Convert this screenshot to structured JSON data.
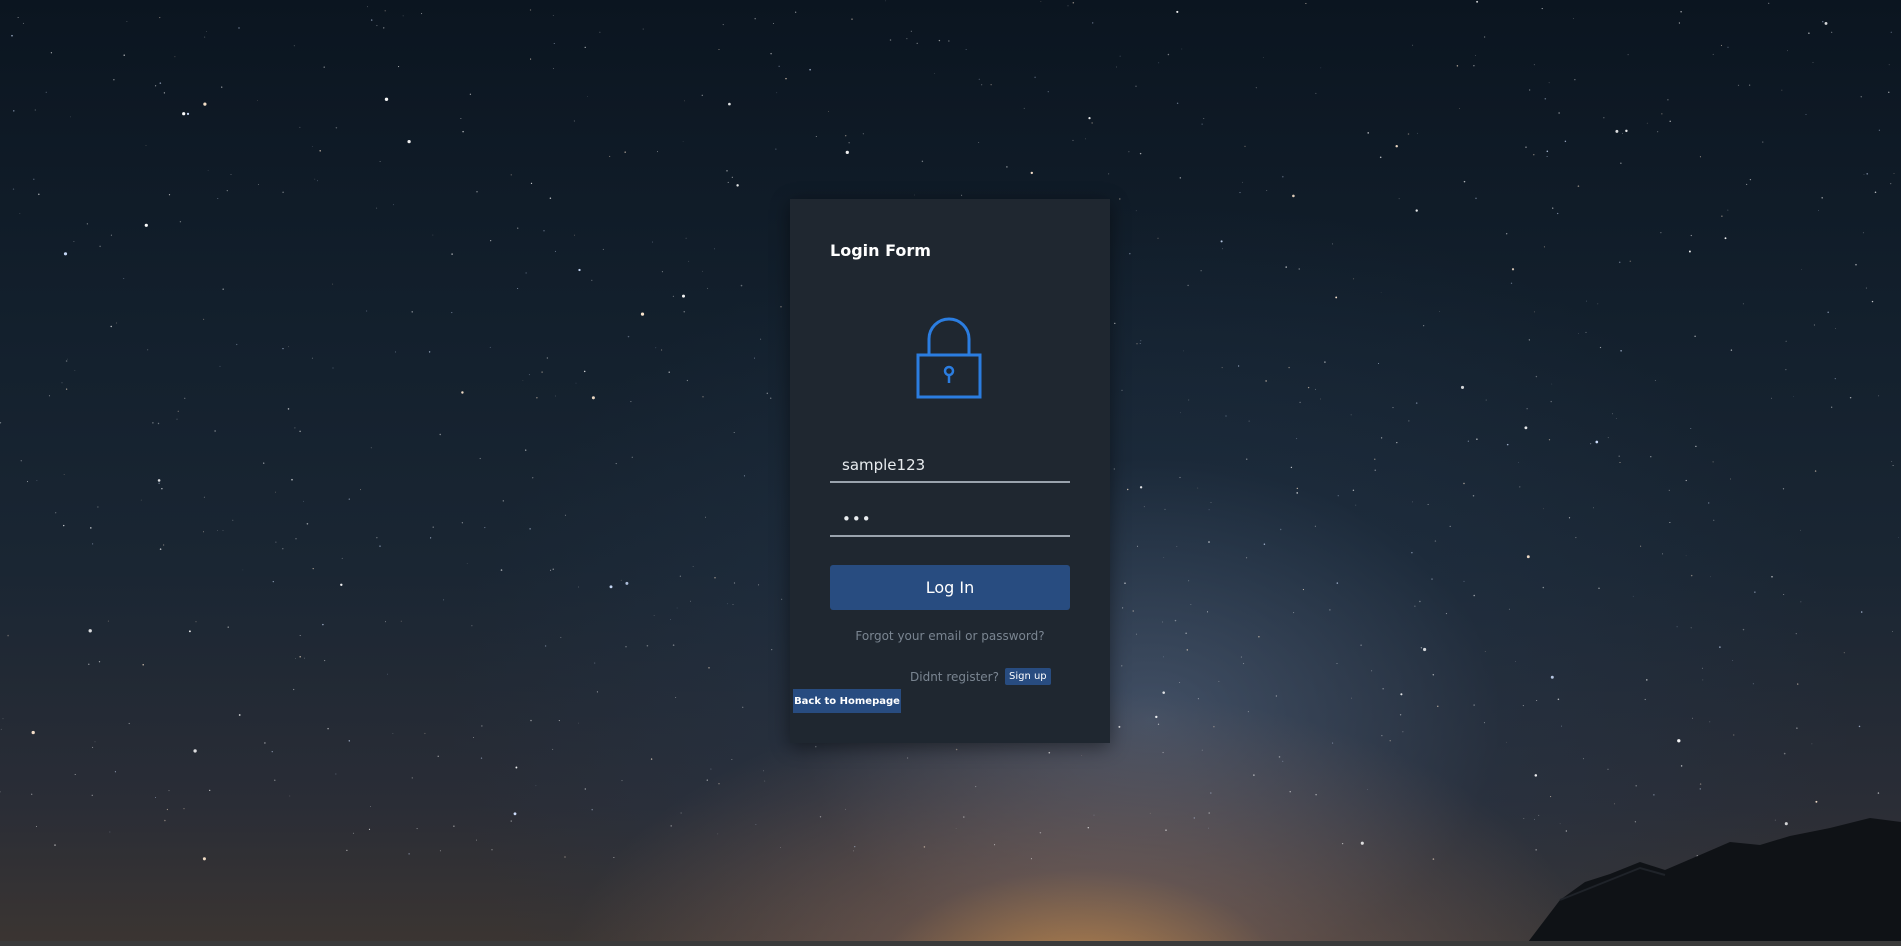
{
  "form": {
    "title": "Login Form",
    "lock_icon": "lock-icon",
    "username_value": "sample123",
    "password_value": "•••",
    "login_label": "Log In",
    "forgot_text": "Forgot your email or password?",
    "register_text": "Didnt register?",
    "signup_label": "Sign up",
    "back_label": "Back to Homepage"
  },
  "colors": {
    "accent": "#2b7de0",
    "button": "#284c80",
    "card": "#1f2730"
  }
}
